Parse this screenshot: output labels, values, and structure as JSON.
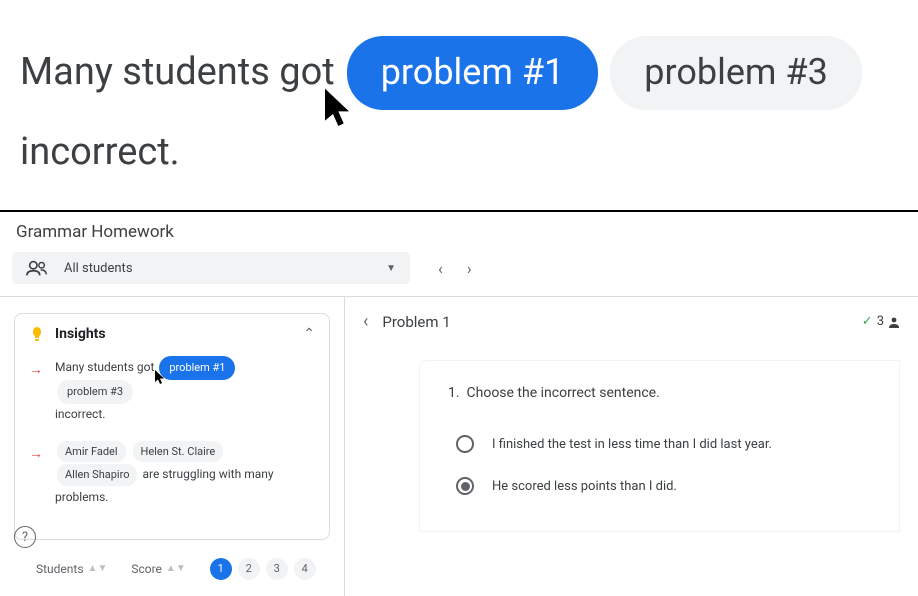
{
  "hero": {
    "text_before": "Many students got",
    "chip_active": "problem #1",
    "chip_inactive": "problem #3",
    "text_after": "incorrect."
  },
  "app_title": "Grammar Homework",
  "filter": {
    "students_label": "All students"
  },
  "insights": {
    "title": "Insights",
    "row1": {
      "text_before": "Many students got",
      "chip_active": "problem #1",
      "chip_inactive": "problem #3",
      "text_after": "incorrect."
    },
    "row2": {
      "student1": "Amir Fadel",
      "student2": "Helen St. Claire",
      "student3": "Allen Shapiro",
      "text_after": "are struggling with many problems."
    }
  },
  "table_controls": {
    "students_label": "Students",
    "score_label": "Score",
    "pages": [
      "1",
      "2",
      "3",
      "4"
    ],
    "active_page": 0
  },
  "problem": {
    "title": "Problem 1",
    "correct_count": "3",
    "question_number": "1.",
    "question_text": "Choose the incorrect sentence.",
    "options": [
      {
        "text": "I finished the test in less time than I did last year.",
        "selected": false
      },
      {
        "text": "He scored less points than I did.",
        "selected": true
      }
    ]
  }
}
